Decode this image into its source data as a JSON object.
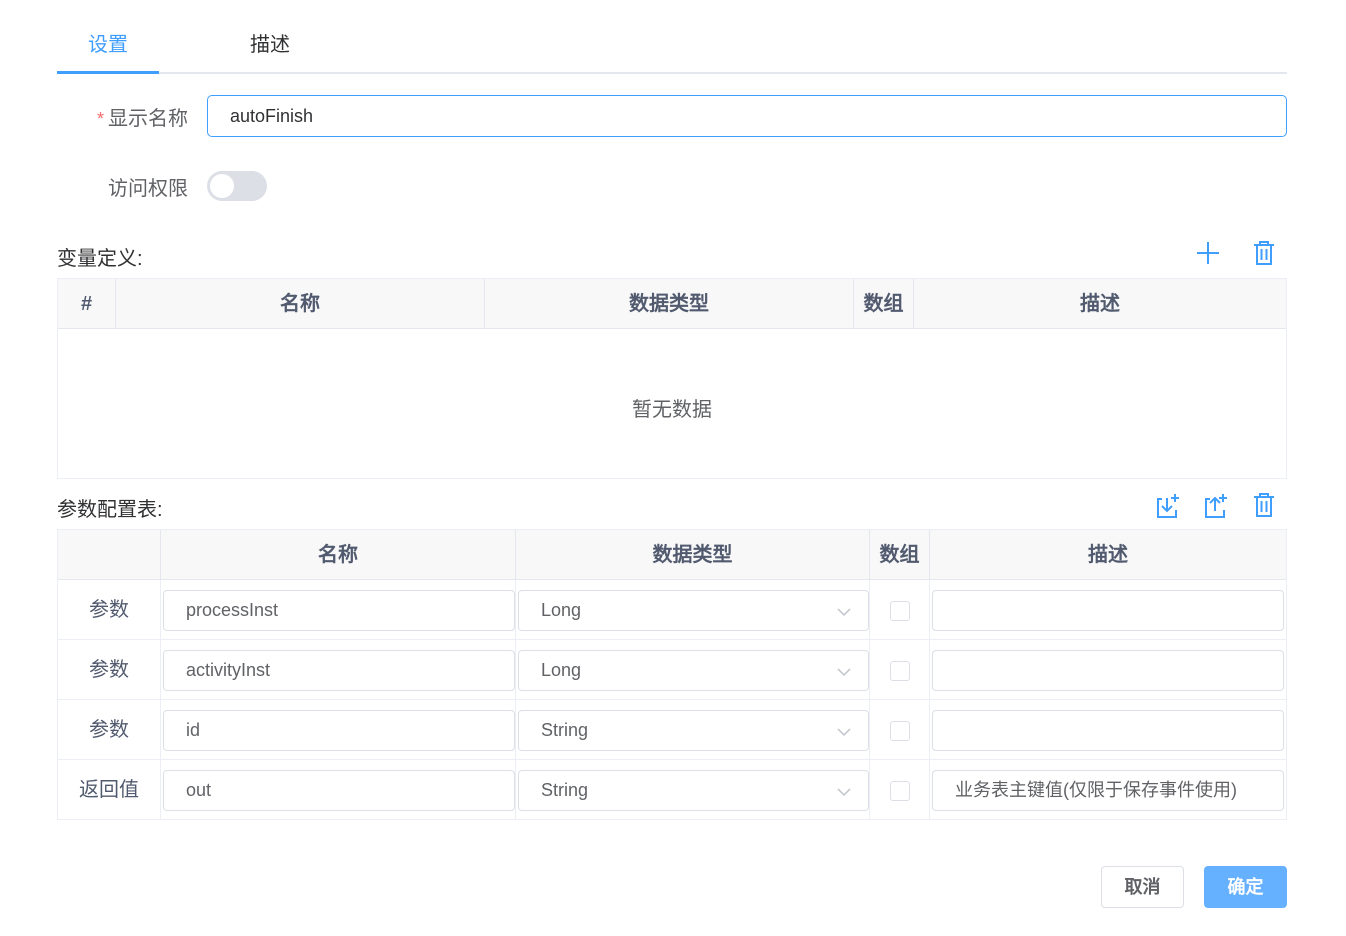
{
  "tabs": [
    {
      "label": "设置",
      "active": true
    },
    {
      "label": "描述",
      "active": false
    }
  ],
  "form": {
    "display_name": {
      "required_mark": "*",
      "label": "显示名称",
      "value": "autoFinish"
    },
    "access": {
      "label": "访问权限",
      "enabled": false
    }
  },
  "variables": {
    "title": "变量定义:",
    "columns": [
      "#",
      "名称",
      "数据类型",
      "数组",
      "描述"
    ],
    "empty_text": "暂无数据",
    "actions": [
      {
        "icon": "plus-icon"
      },
      {
        "icon": "trash-icon"
      }
    ]
  },
  "params": {
    "title": "参数配置表:",
    "columns": [
      "",
      "名称",
      "数据类型",
      "数组",
      "描述"
    ],
    "actions": [
      {
        "icon": "import-icon"
      },
      {
        "icon": "export-icon"
      },
      {
        "icon": "trash-icon"
      }
    ],
    "rows": [
      {
        "kind": "参数",
        "name": "processInst",
        "type": "Long",
        "array": false,
        "desc": ""
      },
      {
        "kind": "参数",
        "name": "activityInst",
        "type": "Long",
        "array": false,
        "desc": ""
      },
      {
        "kind": "参数",
        "name": "id",
        "type": "String",
        "array": false,
        "desc": ""
      },
      {
        "kind": "返回值",
        "name": "out",
        "type": "String",
        "array": false,
        "desc": "业务表主键值(仅限于保存事件使用)"
      }
    ]
  },
  "footer": {
    "cancel_label": "取消",
    "ok_label": "确定"
  },
  "colors": {
    "accent": "#409eff",
    "ok_button": "#66b1ff",
    "required": "#f56c6c"
  }
}
